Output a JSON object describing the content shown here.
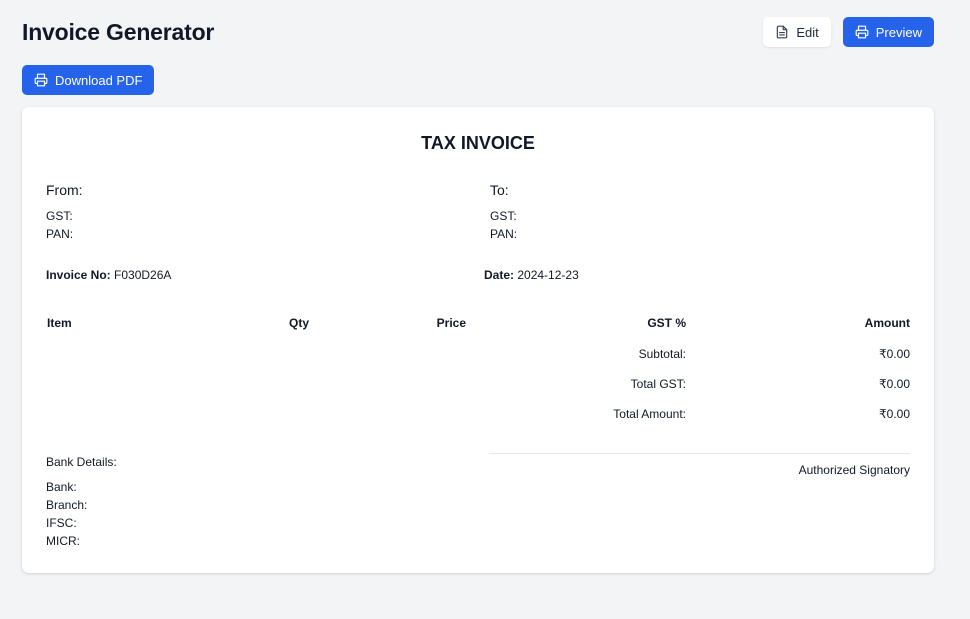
{
  "header": {
    "title": "Invoice Generator",
    "edit_label": "Edit",
    "preview_label": "Preview",
    "download_label": "Download PDF"
  },
  "invoice": {
    "doc_title": "TAX INVOICE",
    "from": {
      "heading": "From:",
      "gst_label": "GST:",
      "pan_label": "PAN:"
    },
    "to": {
      "heading": "To:",
      "gst_label": "GST:",
      "pan_label": "PAN:"
    },
    "invoice_no_label": "Invoice No:",
    "invoice_no": "F030D26A",
    "date_label": "Date:",
    "date": "2024-12-23",
    "table": {
      "headers": [
        "Item",
        "Qty",
        "Price",
        "GST %",
        "Amount"
      ]
    },
    "totals": [
      {
        "label": "Subtotal:",
        "value": "₹0.00"
      },
      {
        "label": "Total GST:",
        "value": "₹0.00"
      },
      {
        "label": "Total Amount:",
        "value": "₹0.00"
      }
    ],
    "bank": {
      "heading": "Bank Details:",
      "bank_label": "Bank:",
      "branch_label": "Branch:",
      "ifsc_label": "IFSC:",
      "micr_label": "MICR:"
    },
    "signatory": "Authorized Signatory"
  },
  "colors": {
    "primary": "#2563eb",
    "background": "#f3f4f6",
    "card": "#ffffff",
    "text": "#111827"
  },
  "icons": {
    "edit": "file-icon",
    "preview": "printer-icon",
    "download": "printer-icon"
  }
}
